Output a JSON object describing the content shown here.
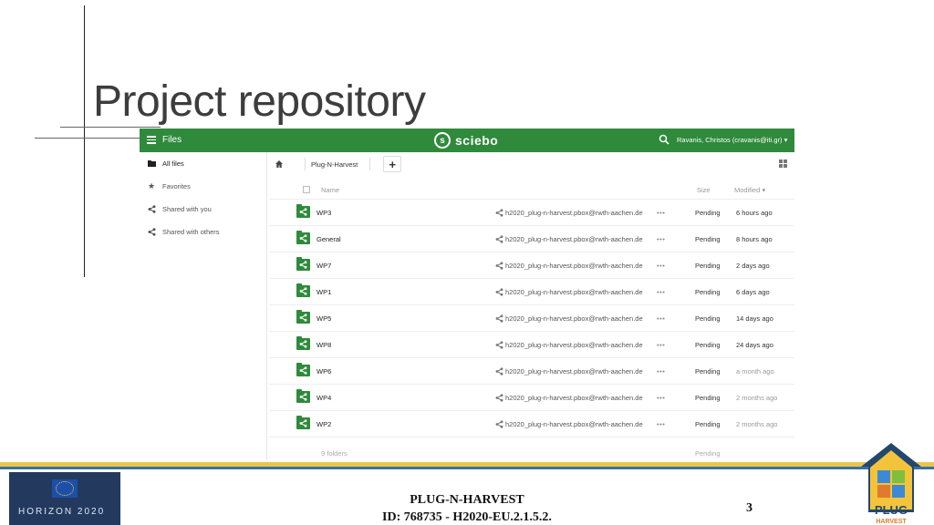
{
  "slide": {
    "title": "Project repository",
    "footer_org": "PLUG-N-HARVEST",
    "footer_id": "ID: 768735 - H2020-EU.2.1.5.2.",
    "page_number": "3",
    "left_logo_text": "HORIZON 2020",
    "right_logo_text": "PLUG HARVEST"
  },
  "app": {
    "menu_label": "Files",
    "brand": "sciebo",
    "user": "Ravanis, Christos (cravanis@iti.gr)",
    "accent_color": "#2f8a3c"
  },
  "sidebar": {
    "items": [
      {
        "label": "All files",
        "icon": "folder-icon"
      },
      {
        "label": "Favorites",
        "icon": "star-icon"
      },
      {
        "label": "Shared with you",
        "icon": "share-icon"
      },
      {
        "label": "Shared with others",
        "icon": "share-icon"
      }
    ]
  },
  "breadcrumb": {
    "folder": "Plug-N-Harvest",
    "add_label": "+"
  },
  "table": {
    "col_name": "Name",
    "col_size": "Size",
    "col_modified": "Modified",
    "rows": [
      {
        "name": "WP3",
        "owner": "h2020_plug-n-harvest.pbox@rwth-aachen.de",
        "actions": "•••",
        "size": "Pending",
        "modified": "6 hours ago"
      },
      {
        "name": "General",
        "owner": "h2020_plug-n-harvest.pbox@rwth-aachen.de",
        "actions": "•••",
        "size": "Pending",
        "modified": "8 hours ago"
      },
      {
        "name": "WP7",
        "owner": "h2020_plug-n-harvest.pbox@rwth-aachen.de",
        "actions": "•••",
        "size": "Pending",
        "modified": "2 days ago"
      },
      {
        "name": "WP1",
        "owner": "h2020_plug-n-harvest.pbox@rwth-aachen.de",
        "actions": "•••",
        "size": "Pending",
        "modified": "6 days ago"
      },
      {
        "name": "WP5",
        "owner": "h2020_plug-n-harvest.pbox@rwth-aachen.de",
        "actions": "•••",
        "size": "Pending",
        "modified": "14 days ago"
      },
      {
        "name": "WP8",
        "owner": "h2020_plug-n-harvest.pbox@rwth-aachen.de",
        "actions": "•••",
        "size": "Pending",
        "modified": "24 days ago"
      },
      {
        "name": "WP6",
        "owner": "h2020_plug-n-harvest.pbox@rwth-aachen.de",
        "actions": "•••",
        "size": "Pending",
        "modified": "a month ago"
      },
      {
        "name": "WP4",
        "owner": "h2020_plug-n-harvest.pbox@rwth-aachen.de",
        "actions": "•••",
        "size": "Pending",
        "modified": "2 months ago"
      },
      {
        "name": "WP2",
        "owner": "h2020_plug-n-harvest.pbox@rwth-aachen.de",
        "actions": "•••",
        "size": "Pending",
        "modified": "2 months ago"
      }
    ],
    "summary_count": "9 folders",
    "summary_size": "Pending"
  }
}
